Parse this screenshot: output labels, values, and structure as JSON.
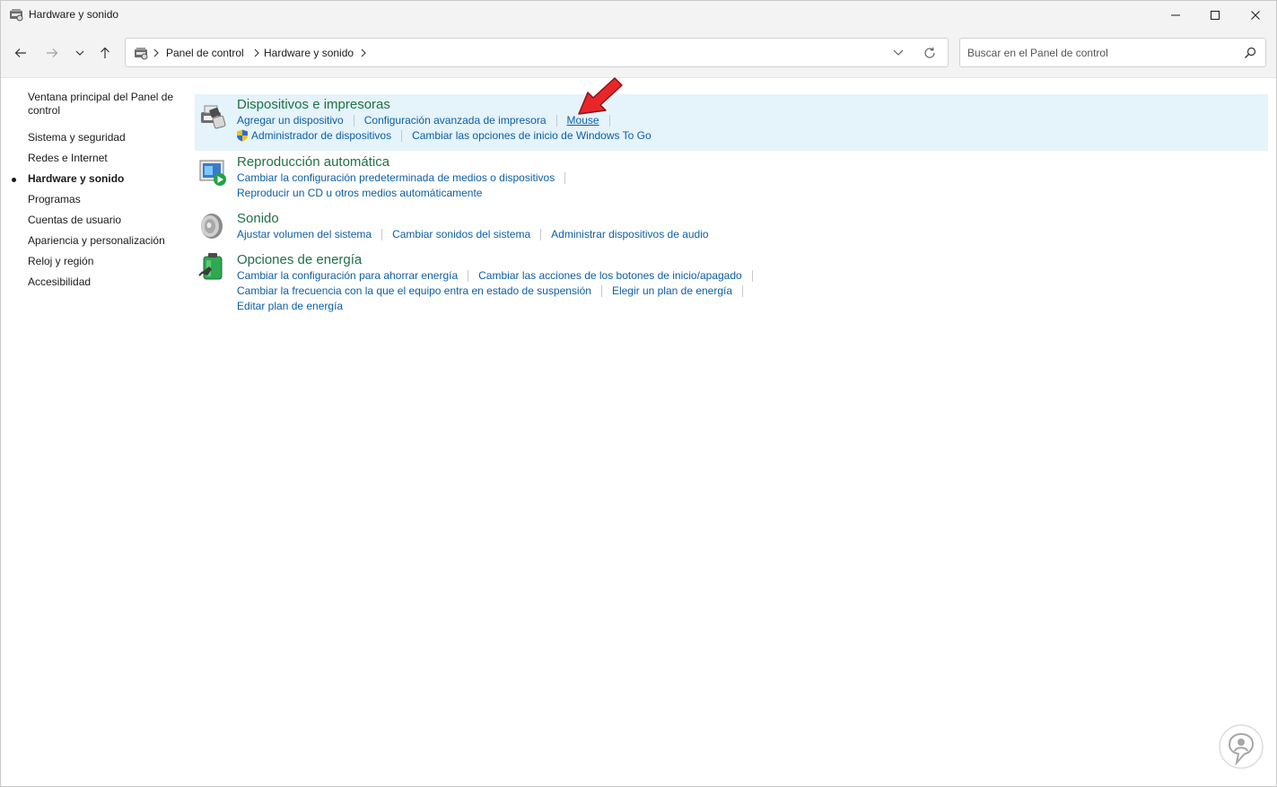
{
  "window": {
    "title": "Hardware y sonido"
  },
  "address": {
    "crumbs": [
      "Panel de control",
      "Hardware y sonido"
    ]
  },
  "search": {
    "placeholder": "Buscar en el Panel de control"
  },
  "sidebar": {
    "items": [
      {
        "label": "Ventana principal del Panel de control"
      },
      {
        "label": "Sistema y seguridad"
      },
      {
        "label": "Redes e Internet"
      },
      {
        "label": "Hardware y sonido",
        "active": true
      },
      {
        "label": "Programas"
      },
      {
        "label": "Cuentas de usuario"
      },
      {
        "label": "Apariencia y personalización"
      },
      {
        "label": "Reloj y región"
      },
      {
        "label": "Accesibilidad"
      }
    ]
  },
  "categories": [
    {
      "title": "Dispositivos e impresoras",
      "icon": "printer-icon",
      "rows": [
        [
          "Agregar un dispositivo",
          "Configuración avanzada de impresora",
          "Mouse"
        ],
        [
          "Administrador de dispositivos",
          "Cambiar las opciones de inicio de Windows To Go"
        ]
      ]
    },
    {
      "title": "Reproducción automática",
      "icon": "autoplay-icon",
      "rows": [
        [
          "Cambiar la configuración predeterminada de medios o dispositivos"
        ],
        [
          "Reproducir un CD u otros medios automáticamente"
        ]
      ]
    },
    {
      "title": "Sonido",
      "icon": "speaker-icon",
      "rows": [
        [
          "Ajustar volumen del sistema",
          "Cambiar sonidos del sistema",
          "Administrar dispositivos de audio"
        ]
      ]
    },
    {
      "title": "Opciones de energía",
      "icon": "battery-icon",
      "rows": [
        [
          "Cambiar la configuración para ahorrar energía",
          "Cambiar las acciones de los botones de inicio/apagado"
        ],
        [
          "Cambiar la frecuencia con la que el equipo entra en estado de suspensión",
          "Elegir un plan de energía"
        ],
        [
          "Editar plan de energía"
        ]
      ]
    }
  ],
  "colors": {
    "link": "#0c5ea7",
    "category_title": "#1e7145",
    "highlight": "#e5f3fb",
    "pointer_arrow": "#e8262a"
  }
}
